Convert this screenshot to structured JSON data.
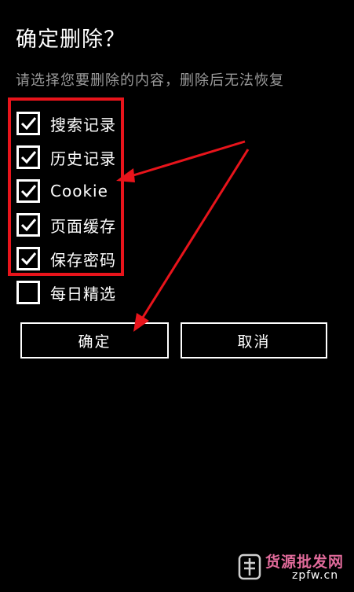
{
  "dialog": {
    "title": "确定删除？",
    "subtitle": "请选择您要删除的内容，删除后无法恢复"
  },
  "options": [
    {
      "label": "搜索记录",
      "checked": true
    },
    {
      "label": "历史记录",
      "checked": true
    },
    {
      "label": "Cookie",
      "checked": true
    },
    {
      "label": "页面缓存",
      "checked": true
    },
    {
      "label": "保存密码",
      "checked": true
    },
    {
      "label": "每日精选",
      "checked": false
    }
  ],
  "buttons": {
    "confirm": "确定",
    "cancel": "取消"
  },
  "annotation": {
    "color": "#e8141b"
  },
  "watermark": {
    "text_line1": "货源批发网",
    "text_line2": "zpfw.cn"
  }
}
